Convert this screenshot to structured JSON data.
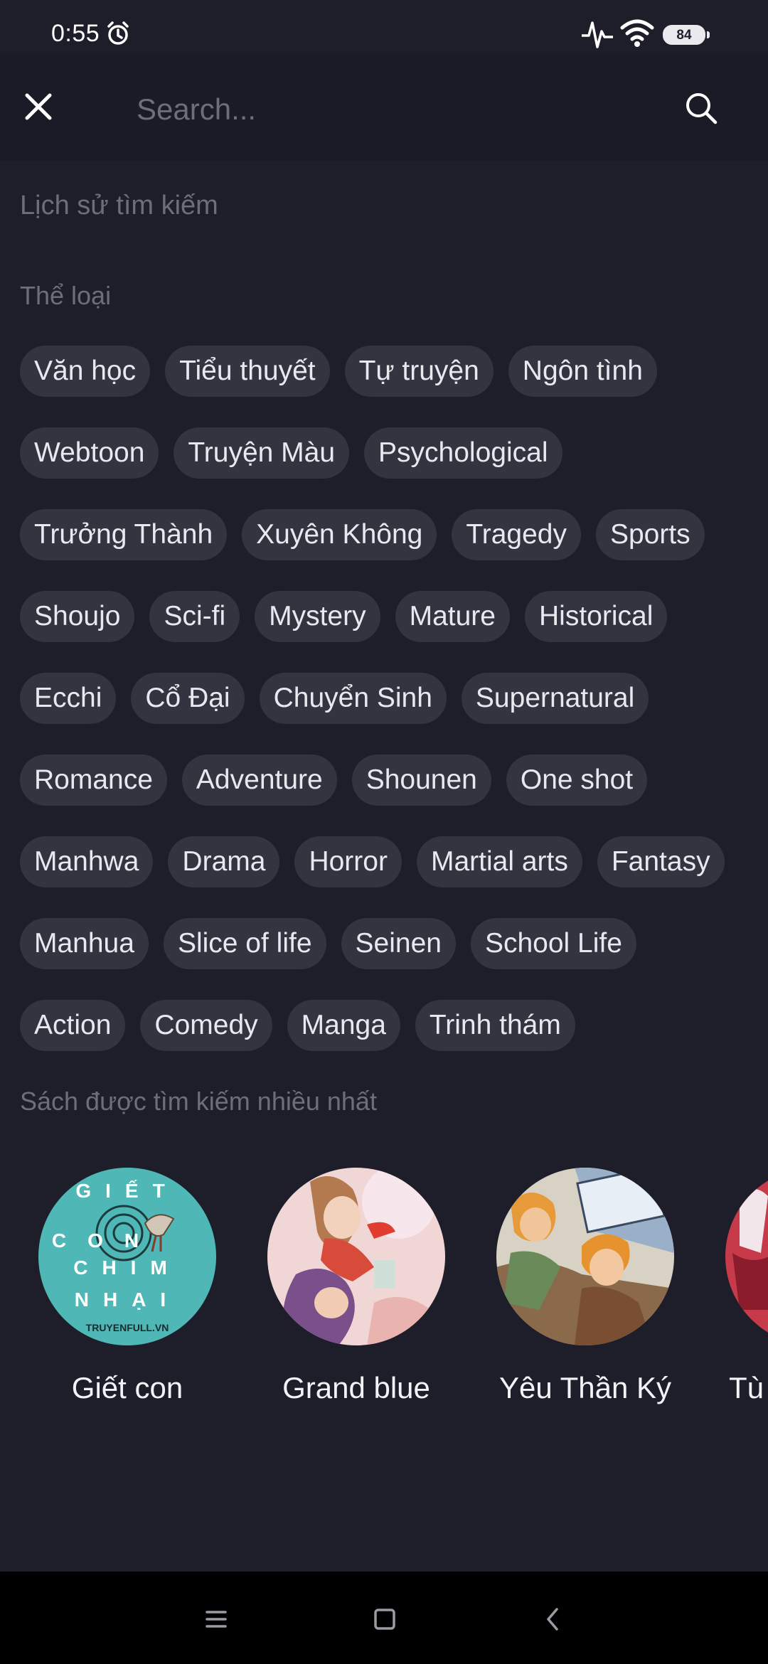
{
  "status_bar": {
    "time": "0:55",
    "battery": "84",
    "icons": [
      "alarm-icon",
      "pulse-icon",
      "wifi-icon",
      "battery-icon"
    ]
  },
  "search": {
    "placeholder": "Search...",
    "value": "",
    "close_icon": "close-icon",
    "search_icon": "search-icon"
  },
  "history": {
    "label": "Lịch sử tìm kiếm"
  },
  "genres": {
    "label": "Thể loại",
    "items": [
      "Văn học",
      "Tiểu thuyết",
      "Tự truyện",
      "Ngôn tình",
      "Webtoon",
      "Truyện Màu",
      "Psychological",
      "Trưởng Thành",
      "Xuyên Không",
      "Tragedy",
      "Sports",
      "Shoujo",
      "Sci-fi",
      "Mystery",
      "Mature",
      "Historical",
      "Ecchi",
      "Cổ Đại",
      "Chuyển Sinh",
      "Supernatural",
      "Romance",
      "Adventure",
      "Shounen",
      "One shot",
      "Manhwa",
      "Drama",
      "Horror",
      "Martial arts",
      "Fantasy",
      "Manhua",
      "Slice of life",
      "Seinen",
      "School Life",
      "Action",
      "Comedy",
      "Manga",
      "Trinh thám"
    ]
  },
  "popular": {
    "label": "Sách được tìm kiếm nhiều nhất",
    "books": [
      {
        "title": "Giết con",
        "cover_lines": [
          "GIẾT",
          "CON",
          "CHIM",
          "NHẠI"
        ],
        "cover_footer": "TRUYENFULL.VN",
        "cover_color": "#4fb7b5"
      },
      {
        "title": "Grand blue",
        "cover_color": "#f1d6d6"
      },
      {
        "title": "Yêu Thần Ký",
        "cover_color": "#8a6a4a"
      },
      {
        "title": "Tù",
        "cover_color": "#c63a4a"
      }
    ]
  },
  "nav": {
    "icons": [
      "menu-icon",
      "home-icon",
      "back-icon"
    ]
  },
  "colors": {
    "background": "#1d1e2a",
    "chip": "#32343f",
    "label": "#6c6e7a"
  }
}
